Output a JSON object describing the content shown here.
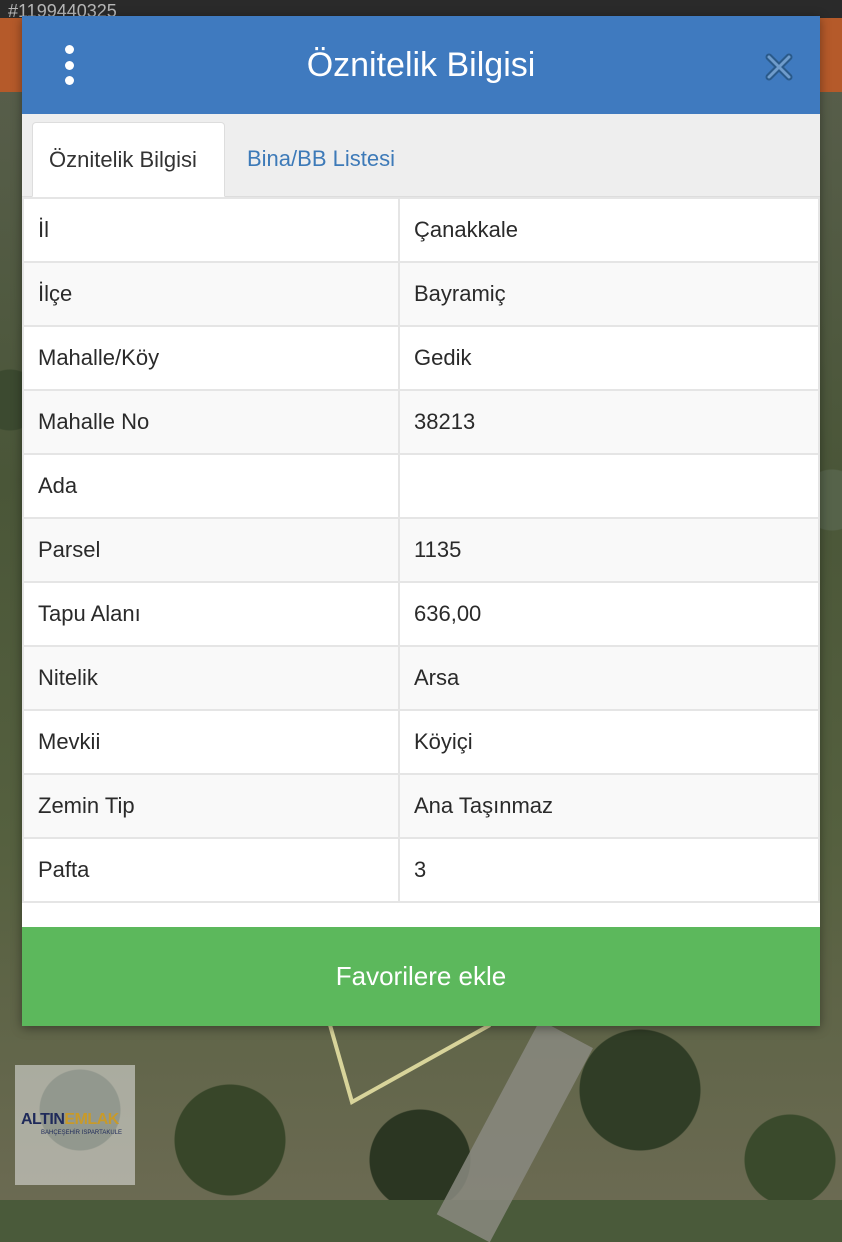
{
  "listing_id": "#1199440325",
  "dialog": {
    "title": "Öznitelik Bilgisi",
    "menu_icon": "vertical-dots-icon",
    "close_icon": "close-icon"
  },
  "tabs": [
    {
      "label": "Öznitelik Bilgisi",
      "active": true
    },
    {
      "label": "Bina/BB Listesi",
      "active": false
    }
  ],
  "attributes": [
    {
      "key": "İl",
      "value": "Çanakkale"
    },
    {
      "key": "İlçe",
      "value": "Bayramiç"
    },
    {
      "key": "Mahalle/Köy",
      "value": "Gedik"
    },
    {
      "key": "Mahalle No",
      "value": "38213"
    },
    {
      "key": "Ada",
      "value": ""
    },
    {
      "key": "Parsel",
      "value": "1135"
    },
    {
      "key": "Tapu Alanı",
      "value": "636,00"
    },
    {
      "key": "Nitelik",
      "value": "Arsa"
    },
    {
      "key": "Mevkii",
      "value": "Köyiçi"
    },
    {
      "key": "Zemin Tip",
      "value": "Ana Taşınmaz"
    },
    {
      "key": "Pafta",
      "value": "3"
    }
  ],
  "favorite_button": {
    "label": "Favorilere ekle"
  },
  "watermark": {
    "brand_part1": "ALTIN",
    "brand_part2": "EMLAK",
    "tagline": "BAHÇEŞEHİR ISPARTAKULE"
  },
  "colors": {
    "header": "#3f7abf",
    "tab_link": "#3d7ab8",
    "favorite": "#5cb85c",
    "close": "#2a5a8a"
  }
}
